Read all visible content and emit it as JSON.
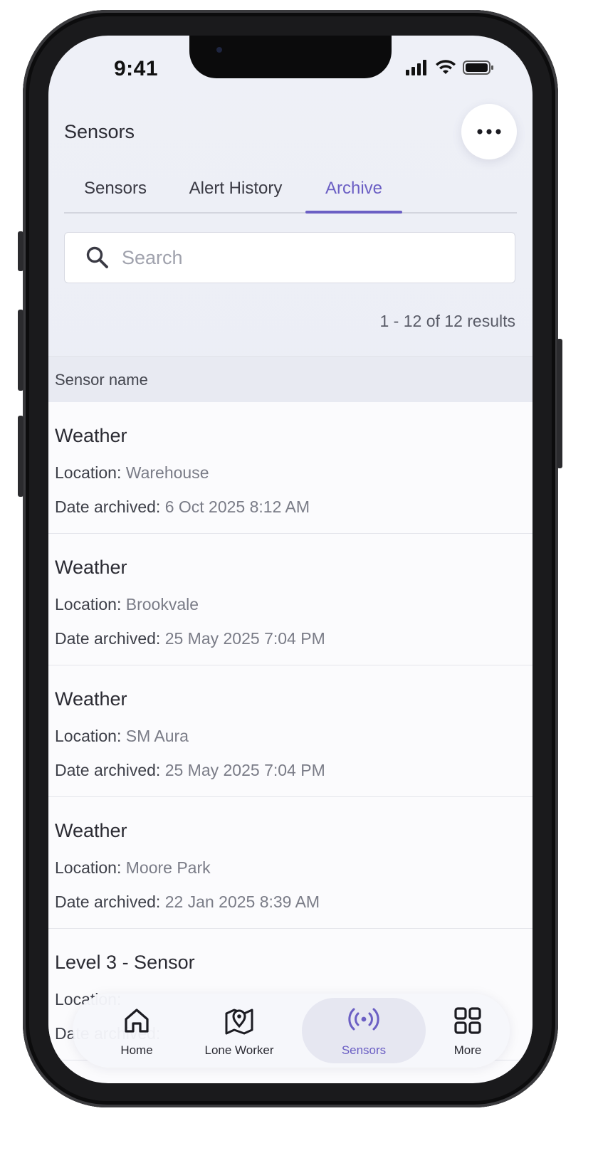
{
  "status_bar": {
    "time": "9:41"
  },
  "header": {
    "title": "Sensors",
    "more_icon": "ellipsis-icon"
  },
  "tabs": [
    {
      "label": "Sensors",
      "active": false
    },
    {
      "label": "Alert History",
      "active": false
    },
    {
      "label": "Archive",
      "active": true
    }
  ],
  "search": {
    "placeholder": "Search",
    "value": ""
  },
  "results_summary": "1 - 12 of 12 results",
  "table": {
    "column_header": "Sensor name",
    "location_label": "Location:",
    "date_label": "Date archived:",
    "rows": [
      {
        "name": "Weather",
        "location": "Warehouse",
        "date_archived": "6 Oct 2025 8:12 AM"
      },
      {
        "name": "Weather",
        "location": "Brookvale",
        "date_archived": "25 May 2025 7:04 PM"
      },
      {
        "name": "Weather",
        "location": "SM Aura",
        "date_archived": "25 May 2025 7:04 PM"
      },
      {
        "name": "Weather",
        "location": "Moore Park",
        "date_archived": "22 Jan 2025 8:39 AM"
      },
      {
        "name": "Level 3 - Sensor",
        "location": "",
        "date_archived": ""
      }
    ]
  },
  "bottom_nav": [
    {
      "label": "Home",
      "icon": "home-icon",
      "active": false
    },
    {
      "label": "Lone Worker",
      "icon": "map-pin-icon",
      "active": false
    },
    {
      "label": "Sensors",
      "icon": "broadcast-icon",
      "active": true
    },
    {
      "label": "More",
      "icon": "grid-icon",
      "active": false
    }
  ],
  "colors": {
    "accent": "#6b5fc4",
    "background": "#eef0f7"
  }
}
